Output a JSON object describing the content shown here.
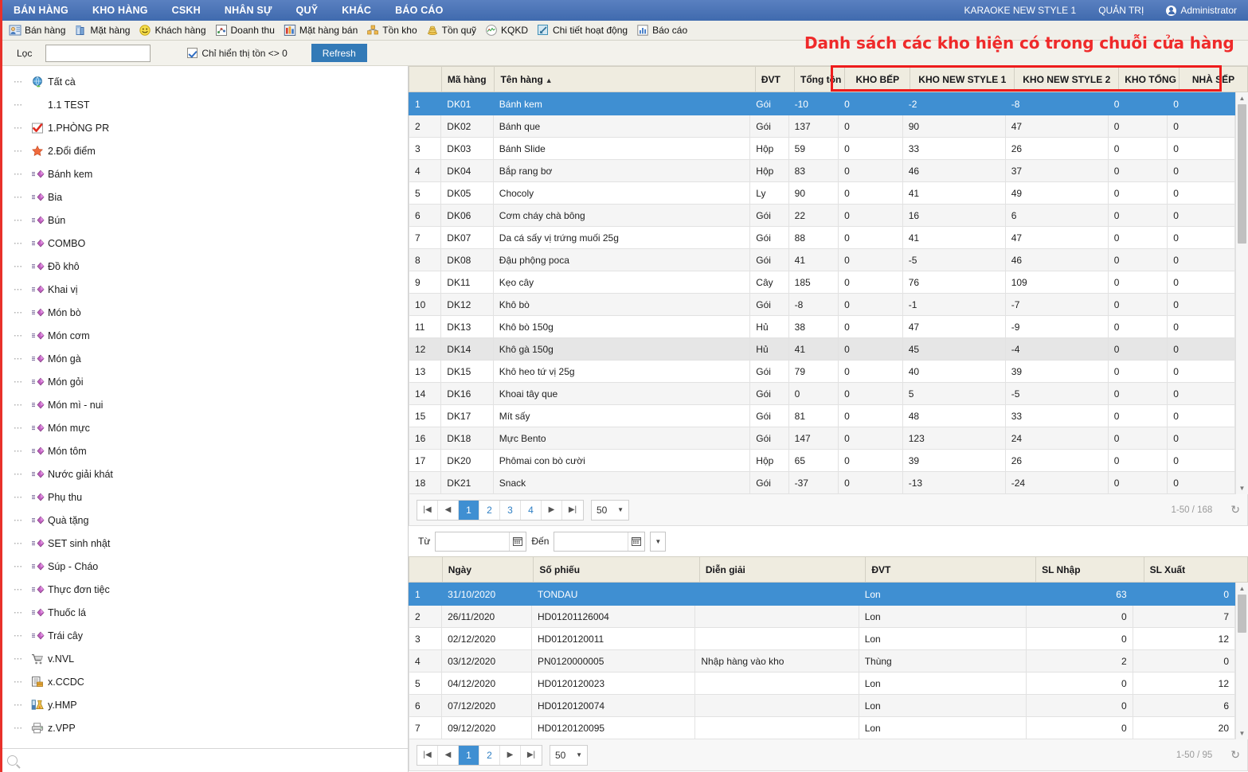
{
  "menubar": {
    "left_items": [
      "BÁN HÀNG",
      "KHO HÀNG",
      "CSKH",
      "NHÂN SỰ",
      "QUỸ",
      "KHÁC",
      "BÁO CÁO"
    ],
    "right_items": [
      "KARAOKE NEW STYLE 1",
      "QUẢN TRỊ"
    ],
    "user": "Administrator"
  },
  "toolbar": {
    "items": [
      {
        "label": "Bán hàng",
        "icon": "sales-person-icon"
      },
      {
        "label": "Mặt hàng",
        "icon": "product-box-icon"
      },
      {
        "label": "Khách hàng",
        "icon": "customer-smiley-icon"
      },
      {
        "label": "Doanh thu",
        "icon": "revenue-chart-icon"
      },
      {
        "label": "Mặt hàng bán",
        "icon": "sold-items-bars-icon"
      },
      {
        "label": "Tồn kho",
        "icon": "inventory-boxes-icon"
      },
      {
        "label": "Tồn quỹ",
        "icon": "cash-stack-icon"
      },
      {
        "label": "KQKD",
        "icon": "business-result-icon"
      },
      {
        "label": "Chi tiết hoạt động",
        "icon": "activity-detail-icon"
      },
      {
        "label": "Báo cáo",
        "icon": "report-bars-icon"
      }
    ]
  },
  "filterbar": {
    "filter_label": "Lọc",
    "filter_value": "",
    "filter_placeholder": "",
    "checkbox_label": "Chỉ hiển thị tồn <> 0",
    "checkbox_checked": true,
    "refresh_label": "Refresh"
  },
  "annotation": {
    "text": "Danh sách các kho hiện có trong chuỗi cửa hàng",
    "color": "#ef2a2a"
  },
  "sidebar": {
    "items": [
      {
        "label": "Tất cà",
        "icon": "globe-icon"
      },
      {
        "label": "1.1 TEST",
        "icon": "none"
      },
      {
        "label": "1.PHÒNG PR",
        "icon": "checkmark-icon"
      },
      {
        "label": "2.Đổi điểm",
        "icon": "star-icon"
      },
      {
        "label": "Bánh kem",
        "icon": "diamond-icon"
      },
      {
        "label": "Bia",
        "icon": "diamond-icon"
      },
      {
        "label": "Bún",
        "icon": "diamond-icon"
      },
      {
        "label": "COMBO",
        "icon": "diamond-icon"
      },
      {
        "label": "Đồ khô",
        "icon": "diamond-icon"
      },
      {
        "label": "Khai vị",
        "icon": "diamond-icon"
      },
      {
        "label": "Món bò",
        "icon": "diamond-icon"
      },
      {
        "label": "Món cơm",
        "icon": "diamond-icon"
      },
      {
        "label": "Món gà",
        "icon": "diamond-icon"
      },
      {
        "label": "Món gỏi",
        "icon": "diamond-icon"
      },
      {
        "label": "Món mì - nui",
        "icon": "diamond-icon"
      },
      {
        "label": "Món mực",
        "icon": "diamond-icon"
      },
      {
        "label": "Món tôm",
        "icon": "diamond-icon"
      },
      {
        "label": "Nước giải khát",
        "icon": "diamond-icon"
      },
      {
        "label": "Phụ thu",
        "icon": "diamond-icon"
      },
      {
        "label": "Quà tặng",
        "icon": "diamond-icon"
      },
      {
        "label": "SET sinh nhật",
        "icon": "diamond-icon"
      },
      {
        "label": "Súp - Cháo",
        "icon": "diamond-icon"
      },
      {
        "label": "Thực đơn tiệc",
        "icon": "diamond-icon"
      },
      {
        "label": "Thuốc lá",
        "icon": "diamond-icon"
      },
      {
        "label": "Trái cây",
        "icon": "diamond-icon"
      },
      {
        "label": "v.NVL",
        "icon": "cart-icon"
      },
      {
        "label": "x.CCDC",
        "icon": "document-box-icon"
      },
      {
        "label": "y.HMP",
        "icon": "flask-icon"
      },
      {
        "label": "z.VPP",
        "icon": "printer-icon"
      }
    ],
    "search_icon": "search-icon",
    "search_value": ""
  },
  "stock_grid": {
    "columns": [
      "",
      "Mã hàng",
      "Tên hàng",
      "ĐVT",
      "Tổng tồn",
      "KHO BẾP",
      "KHO NEW STYLE 1",
      "KHO NEW STYLE 2",
      "KHO TỔNG",
      "NHÀ SẾP"
    ],
    "sorted_column": "Tên hàng",
    "sort_direction": "asc",
    "rows": [
      {
        "no": "1",
        "code": "DK01",
        "name": "Bánh kem",
        "unit": "Gói",
        "total": "-10",
        "k1": "0",
        "k2": "-2",
        "k3": "-8",
        "k4": "0",
        "k5": "0",
        "selected": true
      },
      {
        "no": "2",
        "code": "DK02",
        "name": "Bánh que",
        "unit": "Gói",
        "total": "137",
        "k1": "0",
        "k2": "90",
        "k3": "47",
        "k4": "0",
        "k5": "0"
      },
      {
        "no": "3",
        "code": "DK03",
        "name": "Bánh Slide",
        "unit": "Hộp",
        "total": "59",
        "k1": "0",
        "k2": "33",
        "k3": "26",
        "k4": "0",
        "k5": "0"
      },
      {
        "no": "4",
        "code": "DK04",
        "name": "Bắp rang bơ",
        "unit": "Hộp",
        "total": "83",
        "k1": "0",
        "k2": "46",
        "k3": "37",
        "k4": "0",
        "k5": "0"
      },
      {
        "no": "5",
        "code": "DK05",
        "name": "Chocoly",
        "unit": "Ly",
        "total": "90",
        "k1": "0",
        "k2": "41",
        "k3": "49",
        "k4": "0",
        "k5": "0"
      },
      {
        "no": "6",
        "code": "DK06",
        "name": "Cơm cháy chà bông",
        "unit": "Gói",
        "total": "22",
        "k1": "0",
        "k2": "16",
        "k3": "6",
        "k4": "0",
        "k5": "0"
      },
      {
        "no": "7",
        "code": "DK07",
        "name": "Da cá sấy vị trứng muối 25g",
        "unit": "Gói",
        "total": "88",
        "k1": "0",
        "k2": "41",
        "k3": "47",
        "k4": "0",
        "k5": "0"
      },
      {
        "no": "8",
        "code": "DK08",
        "name": "Đậu phộng poca",
        "unit": "Gói",
        "total": "41",
        "k1": "0",
        "k2": "-5",
        "k3": "46",
        "k4": "0",
        "k5": "0"
      },
      {
        "no": "9",
        "code": "DK11",
        "name": "Kẹo cây",
        "unit": "Cây",
        "total": "185",
        "k1": "0",
        "k2": "76",
        "k3": "109",
        "k4": "0",
        "k5": "0"
      },
      {
        "no": "10",
        "code": "DK12",
        "name": "Khô bò",
        "unit": "Gói",
        "total": "-8",
        "k1": "0",
        "k2": "-1",
        "k3": "-7",
        "k4": "0",
        "k5": "0"
      },
      {
        "no": "11",
        "code": "DK13",
        "name": "Khô bò 150g",
        "unit": "Hủ",
        "total": "38",
        "k1": "0",
        "k2": "47",
        "k3": "-9",
        "k4": "0",
        "k5": "0"
      },
      {
        "no": "12",
        "code": "DK14",
        "name": "Khô gà 150g",
        "unit": "Hủ",
        "total": "41",
        "k1": "0",
        "k2": "45",
        "k3": "-4",
        "k4": "0",
        "k5": "0",
        "highlight": true
      },
      {
        "no": "13",
        "code": "DK15",
        "name": "Khô heo tứ vị 25g",
        "unit": "Gói",
        "total": "79",
        "k1": "0",
        "k2": "40",
        "k3": "39",
        "k4": "0",
        "k5": "0"
      },
      {
        "no": "14",
        "code": "DK16",
        "name": "Khoai tây que",
        "unit": "Gói",
        "total": "0",
        "k1": "0",
        "k2": "5",
        "k3": "-5",
        "k4": "0",
        "k5": "0"
      },
      {
        "no": "15",
        "code": "DK17",
        "name": "Mít sấy",
        "unit": "Gói",
        "total": "81",
        "k1": "0",
        "k2": "48",
        "k3": "33",
        "k4": "0",
        "k5": "0"
      },
      {
        "no": "16",
        "code": "DK18",
        "name": "Mực Bento",
        "unit": "Gói",
        "total": "147",
        "k1": "0",
        "k2": "123",
        "k3": "24",
        "k4": "0",
        "k5": "0"
      },
      {
        "no": "17",
        "code": "DK20",
        "name": "Phômai con bò cười",
        "unit": "Hộp",
        "total": "65",
        "k1": "0",
        "k2": "39",
        "k3": "26",
        "k4": "0",
        "k5": "0"
      },
      {
        "no": "18",
        "code": "DK21",
        "name": "Snack",
        "unit": "Gói",
        "total": "-37",
        "k1": "0",
        "k2": "-13",
        "k3": "-24",
        "k4": "0",
        "k5": "0"
      }
    ],
    "pager": {
      "pages": [
        "1",
        "2",
        "3",
        "4"
      ],
      "active_page": "1",
      "page_size": "50",
      "info": "1-50 / 168"
    }
  },
  "daterange": {
    "from_label": "Từ",
    "from_value": "",
    "to_label": "Đến",
    "to_value": ""
  },
  "detail_grid": {
    "columns": [
      "",
      "Ngày",
      "Số phiếu",
      "Diễn giải",
      "ĐVT",
      "SL Nhập",
      "SL Xuất"
    ],
    "rows": [
      {
        "no": "1",
        "date": "31/10/2020",
        "voucher": "TONDAU",
        "note": "",
        "unit": "Lon",
        "in": "63",
        "out": "0",
        "selected": true
      },
      {
        "no": "2",
        "date": "26/11/2020",
        "voucher": "HD01201126004",
        "note": "",
        "unit": "Lon",
        "in": "0",
        "out": "7"
      },
      {
        "no": "3",
        "date": "02/12/2020",
        "voucher": "HD0120120011",
        "note": "",
        "unit": "Lon",
        "in": "0",
        "out": "12"
      },
      {
        "no": "4",
        "date": "03/12/2020",
        "voucher": "PN0120000005",
        "note": "Nhập hàng vào kho",
        "unit": "Thùng",
        "in": "2",
        "out": "0"
      },
      {
        "no": "5",
        "date": "04/12/2020",
        "voucher": "HD0120120023",
        "note": "",
        "unit": "Lon",
        "in": "0",
        "out": "12"
      },
      {
        "no": "6",
        "date": "07/12/2020",
        "voucher": "HD0120120074",
        "note": "",
        "unit": "Lon",
        "in": "0",
        "out": "6"
      },
      {
        "no": "7",
        "date": "09/12/2020",
        "voucher": "HD0120120095",
        "note": "",
        "unit": "Lon",
        "in": "0",
        "out": "20"
      }
    ],
    "pager": {
      "pages": [
        "1",
        "2"
      ],
      "active_page": "1",
      "page_size": "50",
      "info": "1-50 / 95"
    }
  }
}
